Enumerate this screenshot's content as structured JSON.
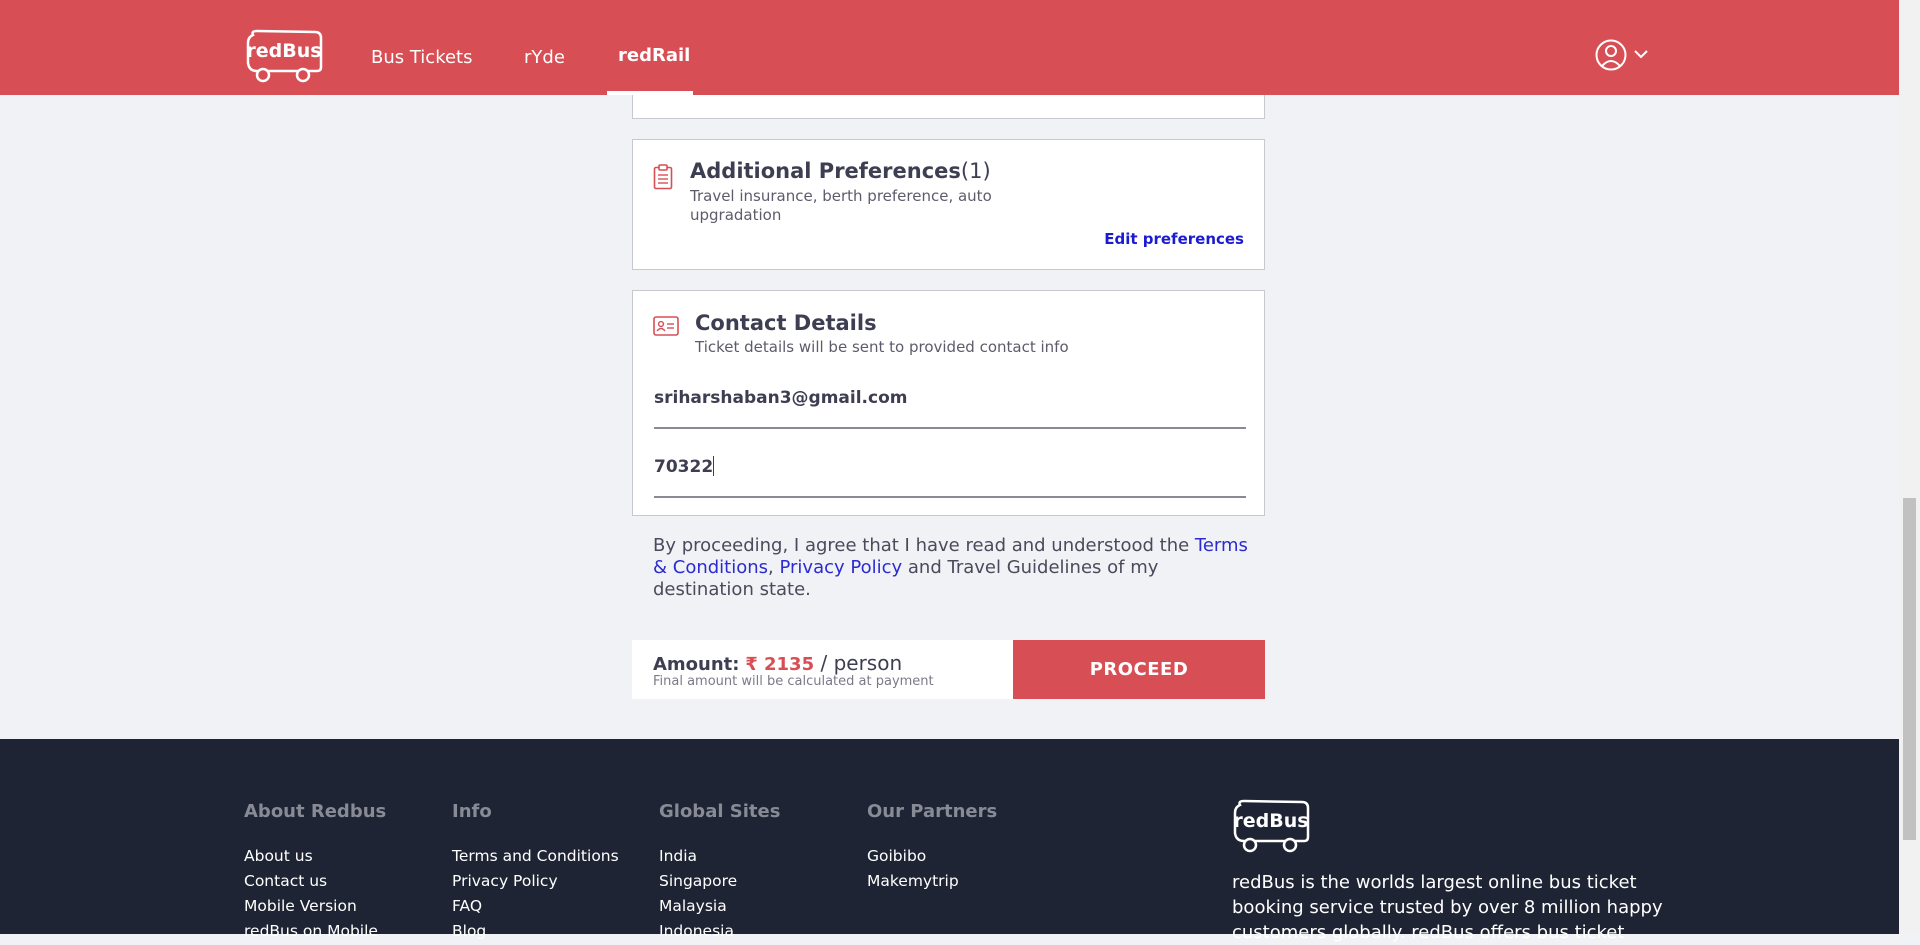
{
  "header": {
    "nav": [
      {
        "label": "Bus Tickets"
      },
      {
        "label": "rYde"
      },
      {
        "label": "redRail"
      }
    ]
  },
  "logo_text": "redBus",
  "preferences": {
    "title": "Additional Preferences",
    "count": "(1)",
    "subtitle": "Travel insurance, berth preference, auto upgradation",
    "edit_label": "Edit preferences"
  },
  "contact": {
    "title": "Contact Details",
    "subtitle": "Ticket details will be sent to provided contact info",
    "email_value": "sriharshaban3@gmail.com",
    "phone_value": "70322"
  },
  "consent": {
    "prefix": "By proceeding, I agree that I have read and understood the ",
    "terms_link": "Terms & Conditions",
    "separator": ", ",
    "privacy_link": "Privacy Policy",
    "suffix": " and Travel Guidelines of my destination state."
  },
  "amount": {
    "label": "Amount:",
    "price": "₹ 2135",
    "unit": " / person",
    "note": "Final amount will be calculated at payment"
  },
  "proceed_label": "PROCEED",
  "footer": {
    "columns": [
      {
        "heading": "About Redbus",
        "links": [
          "About us",
          "Contact us",
          "Mobile Version",
          "redBus on Mobile"
        ]
      },
      {
        "heading": "Info",
        "links": [
          "Terms and Conditions",
          "Privacy Policy",
          "FAQ",
          "Blog"
        ]
      },
      {
        "heading": "Global Sites",
        "links": [
          "India",
          "Singapore",
          "Malaysia",
          "Indonesia"
        ]
      },
      {
        "heading": "Our Partners",
        "links": [
          "Goibibo",
          "Makemytrip"
        ]
      }
    ],
    "description": "redBus is the worlds largest online bus ticket booking service trusted by over 8 million happy customers globally. redBus offers bus ticket"
  },
  "colors": {
    "brand_red": "#d84e55",
    "link_blue": "#1b1bd0",
    "footer_bg": "#1e2433",
    "page_bg": "#f0f2f5"
  },
  "icons": [
    "redbus-logo",
    "user-icon",
    "chevron-down-icon",
    "clipboard-icon",
    "id-card-icon"
  ]
}
